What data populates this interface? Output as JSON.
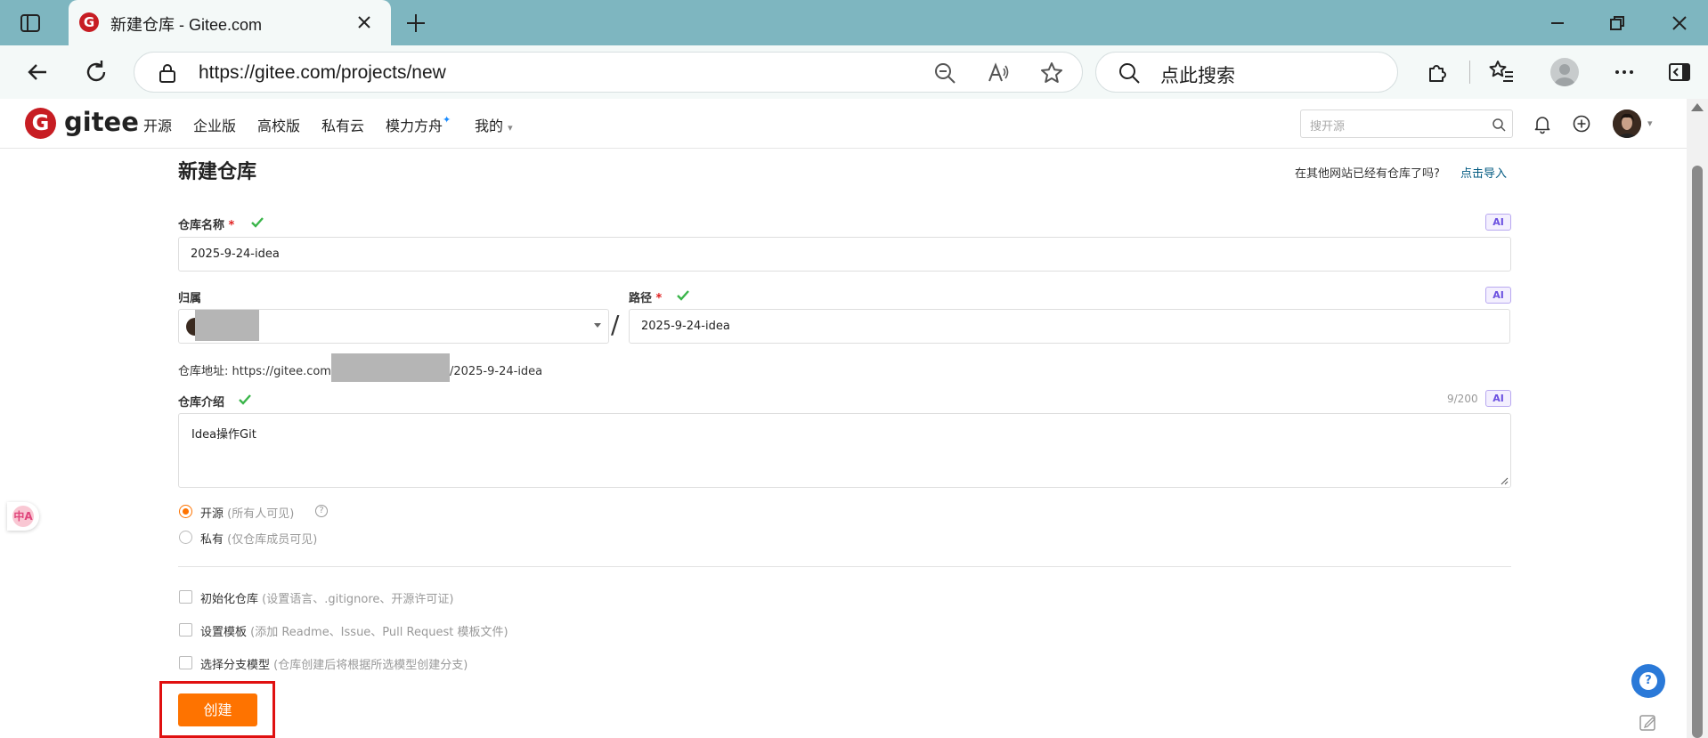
{
  "browser": {
    "tab_title": "新建仓库 - Gitee.com",
    "url": "https://gitee.com/projects/new",
    "search_placeholder": "点此搜索"
  },
  "site": {
    "logo_letter": "G",
    "logo_text": "gitee",
    "menu": [
      "开源",
      "企业版",
      "高校版",
      "私有云",
      "模力方舟",
      "我的"
    ],
    "spark": "✦",
    "search_placeholder": "搜开源"
  },
  "form": {
    "title": "新建仓库",
    "import_question": "在其他网站已经有仓库了吗?",
    "import_link": "点击导入",
    "repo_name_label": "仓库名称",
    "required_mark": "*",
    "repo_name_value": "2025-9-24-idea",
    "ai_badge": "AI",
    "owner_label": "归属",
    "path_label": "路径",
    "path_value": "2025-9-24-idea",
    "separator": "/",
    "address_prefix": "仓库地址: https://gitee.com",
    "address_suffix": "/2025-9-24-idea",
    "intro_label": "仓库介绍",
    "intro_counter": "9/200",
    "intro_value": "Idea操作Git",
    "visibility": [
      {
        "label": "开源",
        "note": "(所有人可见)",
        "selected": true
      },
      {
        "label": "私有",
        "note": "(仅仓库成员可见)",
        "selected": false
      }
    ],
    "help_mark": "?",
    "options": [
      {
        "label": "初始化仓库",
        "note": "(设置语言、.gitignore、开源许可证)"
      },
      {
        "label": "设置模板",
        "note": "(添加 Readme、Issue、Pull Request 模板文件)"
      },
      {
        "label": "选择分支模型",
        "note": "(仓库创建后将根据所选模型创建分支)"
      }
    ],
    "create_button": "创建"
  },
  "widgets": {
    "translate_label": "中A",
    "help_label": "?"
  },
  "colors": {
    "accent": "#fe7300",
    "brand": "#c71d23",
    "link": "#005980",
    "check": "#3ab54a",
    "highlight": "#e01010"
  }
}
